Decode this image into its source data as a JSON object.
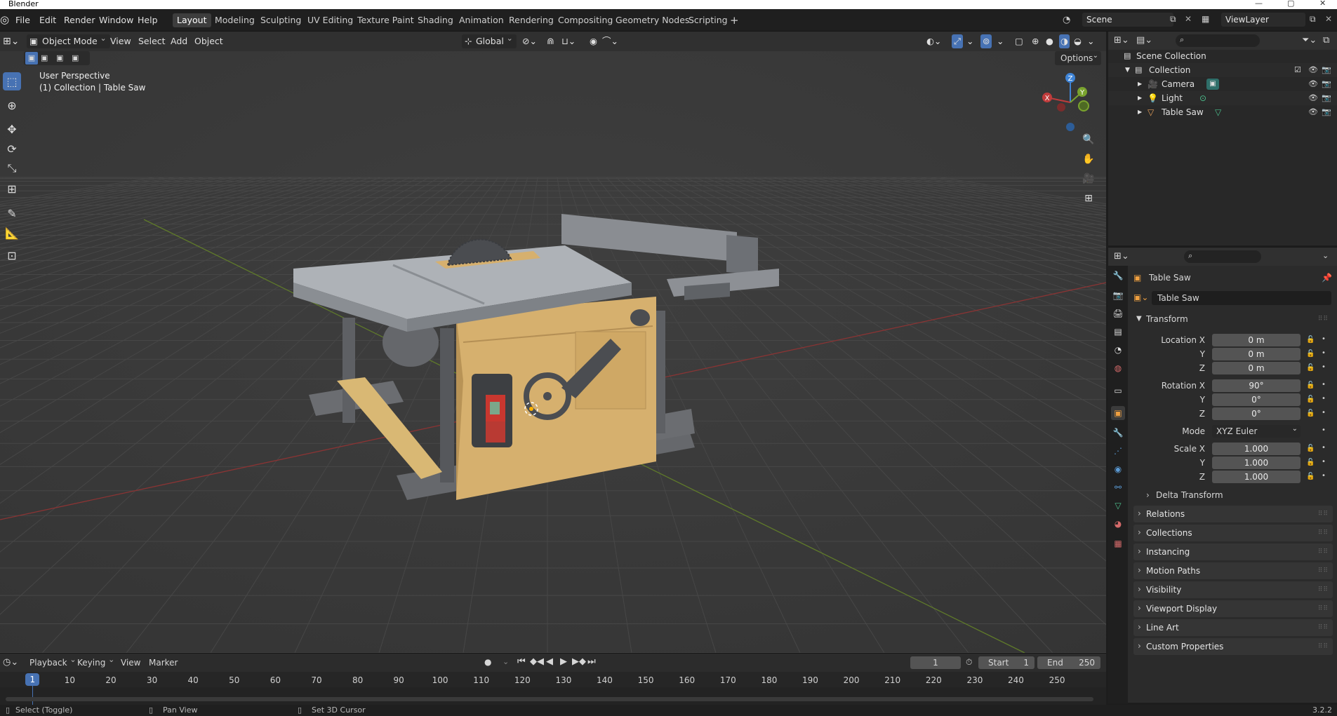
{
  "window": {
    "title": "Blender"
  },
  "menu": [
    "File",
    "Edit",
    "Render",
    "Window",
    "Help"
  ],
  "workspaces": [
    "Layout",
    "Modeling",
    "Sculpting",
    "UV Editing",
    "Texture Paint",
    "Shading",
    "Animation",
    "Rendering",
    "Compositing",
    "Geometry Nodes",
    "Scripting"
  ],
  "active_workspace": "Layout",
  "scene": {
    "scene_name": "Scene",
    "view_layer": "ViewLayer"
  },
  "viewport_header": {
    "mode": "Object Mode",
    "menus": [
      "View",
      "Select",
      "Add",
      "Object"
    ],
    "orientation": "Global",
    "options_label": "Options"
  },
  "viewport": {
    "perspective_label": "User Perspective",
    "context_label": "(1) Collection | Table Saw",
    "gizmo": {
      "x": "X",
      "y": "Y",
      "z": "Z"
    }
  },
  "outliner": {
    "root": "Scene Collection",
    "collection": "Collection",
    "items": [
      {
        "name": "Camera",
        "icon": "camera-icon"
      },
      {
        "name": "Light",
        "icon": "light-icon"
      },
      {
        "name": "Table Saw",
        "icon": "mesh-icon"
      }
    ]
  },
  "properties": {
    "object_name_header": "Table Saw",
    "object_name_field": "Table Saw",
    "transform_panel": "Transform",
    "location_label": "Location X",
    "location": [
      "0 m",
      "0 m",
      "0 m"
    ],
    "rotation_label": "Rotation X",
    "rotation": [
      "90°",
      "0°",
      "0°"
    ],
    "mode_label": "Mode",
    "mode_value": "XYZ Euler",
    "scale_label": "Scale X",
    "scale": [
      "1.000",
      "1.000",
      "1.000"
    ],
    "axis_y": "Y",
    "axis_z": "Z",
    "delta_transform": "Delta Transform",
    "panels": [
      "Relations",
      "Collections",
      "Instancing",
      "Motion Paths",
      "Visibility",
      "Viewport Display",
      "Line Art",
      "Custom Properties"
    ]
  },
  "timeline": {
    "menus": [
      "Playback",
      "Keying",
      "View",
      "Marker"
    ],
    "current_frame": "1",
    "start_label": "Start",
    "start": "1",
    "end_label": "End",
    "end": "250",
    "ruler": [
      "1",
      "10",
      "20",
      "30",
      "40",
      "50",
      "60",
      "70",
      "80",
      "90",
      "100",
      "110",
      "120",
      "130",
      "140",
      "150",
      "160",
      "170",
      "180",
      "190",
      "200",
      "210",
      "220",
      "230",
      "240",
      "250"
    ]
  },
  "statusbar": {
    "select": "Select (Toggle)",
    "pan": "Pan View",
    "cursor": "Set 3D Cursor",
    "version": "3.2.2"
  },
  "colors": {
    "accent": "#4772b3",
    "x_axis": "#c13c3c",
    "y_axis": "#7aa32e",
    "z_axis": "#3f84d6",
    "saw_body": "#d6b06e",
    "saw_table": "#a3a7ad"
  }
}
